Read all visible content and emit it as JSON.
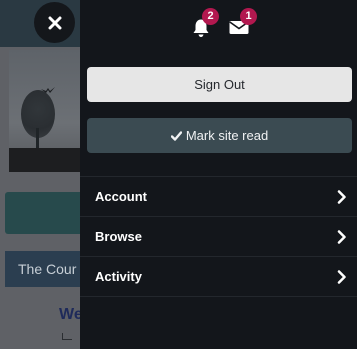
{
  "background": {
    "banner_text": "The Cour",
    "heading_fragment": "We"
  },
  "notifications": {
    "bell_icon": "bell-icon",
    "bell_count": "2",
    "mail_icon": "envelope-icon",
    "mail_count": "1"
  },
  "actions": {
    "sign_out_label": "Sign Out",
    "mark_read_label": "Mark site read",
    "mark_read_icon": "checkmark-icon"
  },
  "menu": {
    "items": [
      {
        "label": "Account"
      },
      {
        "label": "Browse"
      },
      {
        "label": "Activity"
      }
    ]
  },
  "colors": {
    "badge": "#b2184f",
    "panel": "#13161b",
    "sign_out_bg": "#e6e6e6",
    "mark_read_bg": "#3b4b52"
  }
}
